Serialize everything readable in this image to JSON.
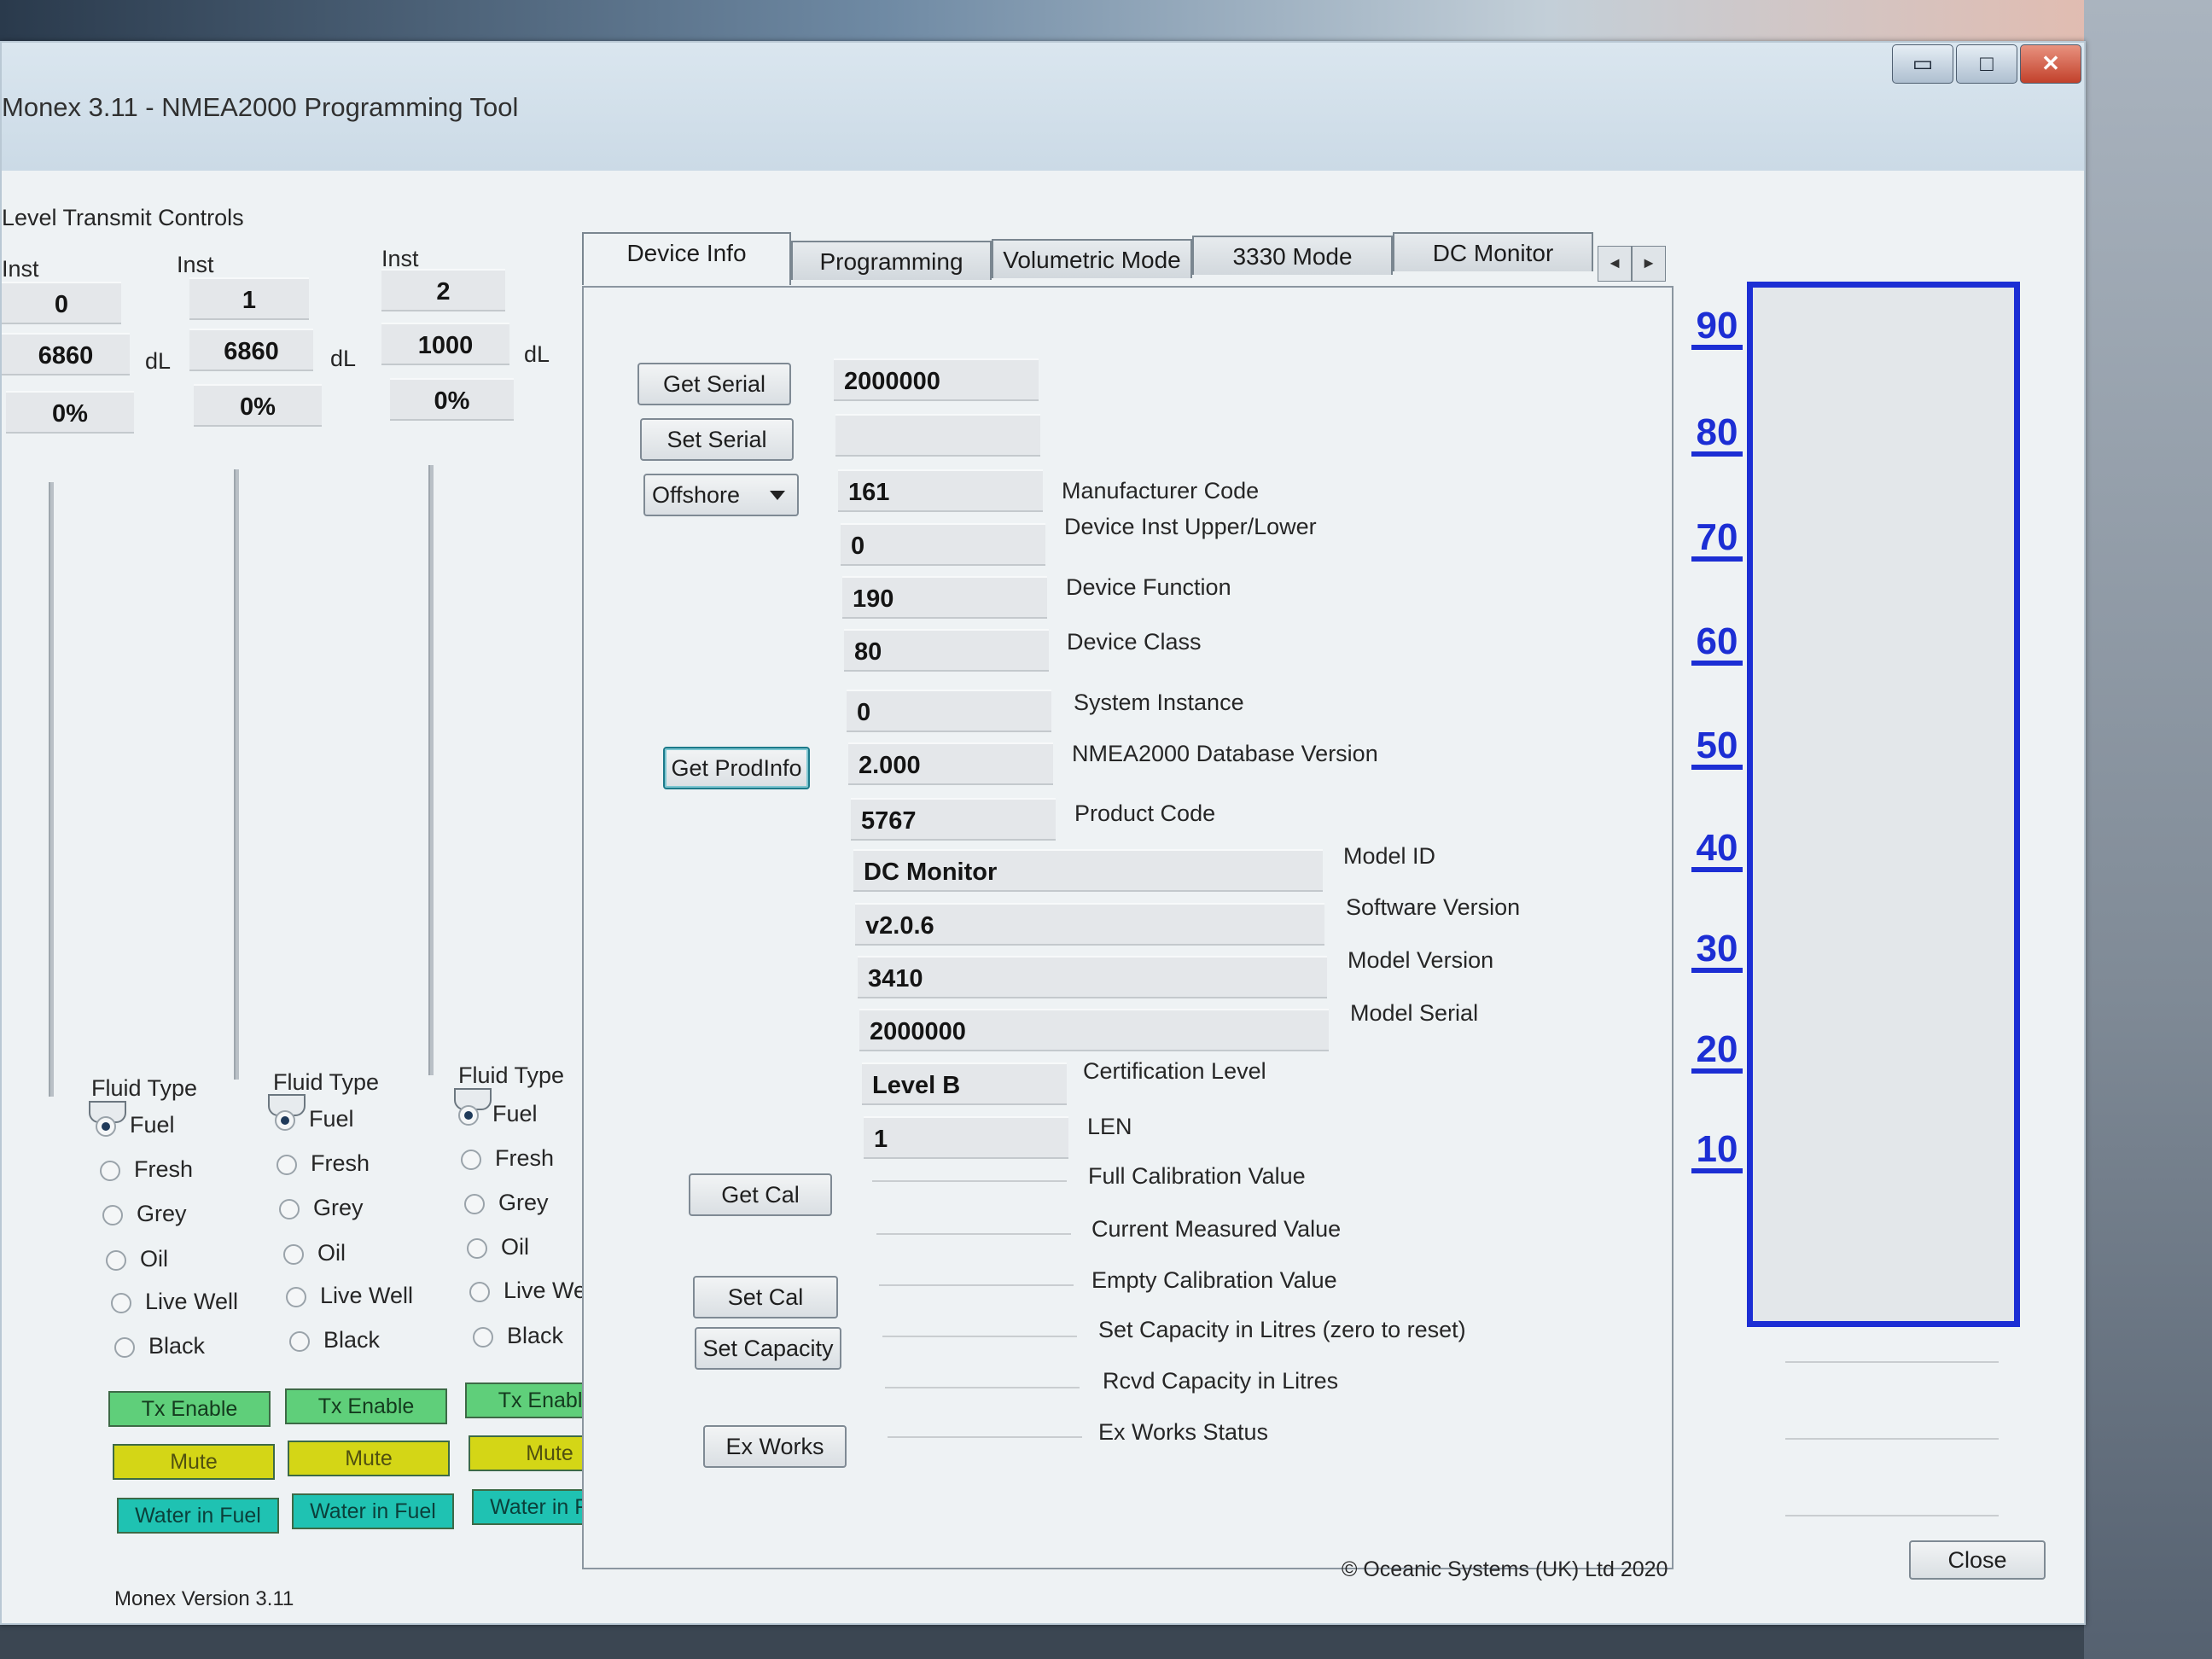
{
  "window": {
    "title": "Monex 3.11 - NMEA2000 Programming Tool",
    "minimize": "▭",
    "maximize": "□",
    "close": "✕"
  },
  "level_controls": {
    "heading": "Level Transmit Controls",
    "unit": "dL",
    "inst_label": "Inst",
    "columns": [
      {
        "inst": "0",
        "value": "6860",
        "percent": "0%"
      },
      {
        "inst": "1",
        "value": "6860",
        "percent": "0%"
      },
      {
        "inst": "2",
        "value": "1000",
        "percent": "0%"
      }
    ],
    "fluid_type_label": "Fluid Type",
    "fluid_options": [
      "Fuel",
      "Fresh",
      "Grey",
      "Oil",
      "Live Well",
      "Black"
    ],
    "selected_fluid": "Fuel",
    "tx_enable": "Tx Enable",
    "mute": "Mute",
    "water_in_fuel": "Water in Fuel"
  },
  "tabs": [
    "Device Info",
    "Programming",
    "Volumetric Mode",
    "3330 Mode",
    "DC Monitor"
  ],
  "active_tab": "Device Info",
  "tab_scroll": {
    "left": "◄",
    "right": "►"
  },
  "device_info": {
    "get_serial": "Get Serial",
    "set_serial": "Set Serial",
    "serial_value": "2000000",
    "serial_input": "",
    "mode_select": "Offshore",
    "get_prodinfo": "Get ProdInfo",
    "get_cal": "Get Cal",
    "set_cal": "Set Cal",
    "set_capacity": "Set Capacity",
    "ex_works": "Ex Works",
    "fields": [
      {
        "value": "161",
        "label": "Manufacturer Code"
      },
      {
        "value": "0",
        "label": "Device Inst Upper/Lower"
      },
      {
        "value": "190",
        "label": "Device Function"
      },
      {
        "value": "80",
        "label": "Device Class"
      },
      {
        "value": "0",
        "label": "System Instance"
      },
      {
        "value": "2.000",
        "label": "NMEA2000 Database Version"
      },
      {
        "value": "5767",
        "label": "Product Code"
      },
      {
        "value": "DC Monitor",
        "label": "Model ID"
      },
      {
        "value": "v2.0.6",
        "label": "Software Version"
      },
      {
        "value": "3410",
        "label": "Model Version"
      },
      {
        "value": "2000000",
        "label": "Model Serial"
      },
      {
        "value": "Level B",
        "label": "Certification Level"
      },
      {
        "value": "1",
        "label": "LEN"
      },
      {
        "value": "",
        "label": "Full Calibration Value"
      },
      {
        "value": "",
        "label": "Current Measured Value"
      },
      {
        "value": "",
        "label": "Empty Calibration Value"
      },
      {
        "value": "",
        "label": "Set Capacity in Litres (zero to reset)"
      },
      {
        "value": "",
        "label": "Rcvd Capacity in Litres"
      },
      {
        "value": "",
        "label": "Ex Works Status"
      }
    ]
  },
  "gauge": {
    "ticks": [
      "90",
      "80",
      "70",
      "60",
      "50",
      "40",
      "30",
      "20",
      "10"
    ],
    "level_percent": 0,
    "color": "#1c2ed4"
  },
  "footer": {
    "copyright": "© Oceanic Systems (UK) Ltd 2020",
    "version": "Monex Version 3.11",
    "close": "Close"
  }
}
